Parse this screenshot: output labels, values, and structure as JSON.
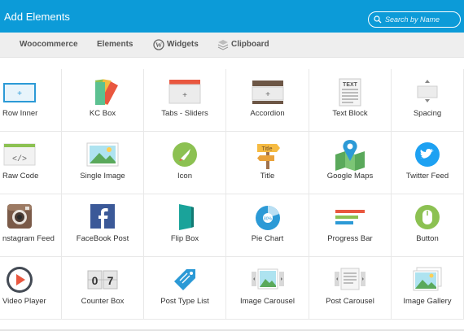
{
  "header": {
    "title": "Add Elements",
    "search_placeholder": "Search by Name"
  },
  "tabs": [
    {
      "label": "Woocommerce",
      "icon": ""
    },
    {
      "label": "Elements",
      "icon": ""
    },
    {
      "label": "Widgets",
      "icon": "wordpress-icon"
    },
    {
      "label": "Clipboard",
      "icon": "layers-icon"
    }
  ],
  "elements": [
    {
      "label": "Row Inner",
      "icon": "row-inner-icon"
    },
    {
      "label": "KC Box",
      "icon": "kc-box-icon"
    },
    {
      "label": "Tabs - Sliders",
      "icon": "tabs-sliders-icon"
    },
    {
      "label": "Accordion",
      "icon": "accordion-icon"
    },
    {
      "label": "Text Block",
      "icon": "text-block-icon"
    },
    {
      "label": "Spacing",
      "icon": "spacing-icon"
    },
    {
      "label": "Raw Code",
      "icon": "raw-code-icon"
    },
    {
      "label": "Single Image",
      "icon": "single-image-icon"
    },
    {
      "label": "Icon",
      "icon": "rocket-icon"
    },
    {
      "label": "Title",
      "icon": "signpost-icon"
    },
    {
      "label": "Google Maps",
      "icon": "map-pin-icon"
    },
    {
      "label": "Twitter Feed",
      "icon": "twitter-icon"
    },
    {
      "label": "nstagram Feed",
      "icon": "instagram-icon"
    },
    {
      "label": "FaceBook Post",
      "icon": "facebook-icon"
    },
    {
      "label": "Flip Box",
      "icon": "flip-box-icon"
    },
    {
      "label": "Pie Chart",
      "icon": "pie-chart-icon"
    },
    {
      "label": "Progress Bar",
      "icon": "progress-bar-icon"
    },
    {
      "label": "Button",
      "icon": "mouse-icon"
    },
    {
      "label": "Video Player",
      "icon": "play-icon"
    },
    {
      "label": "Counter Box",
      "icon": "counter-icon"
    },
    {
      "label": "Post Type List",
      "icon": "tag-icon"
    },
    {
      "label": "Image Carousel",
      "icon": "image-carousel-icon"
    },
    {
      "label": "Post Carousel",
      "icon": "post-carousel-icon"
    },
    {
      "label": "Image Gallery",
      "icon": "image-gallery-icon"
    }
  ],
  "icon_text": {
    "title_sign": "Title",
    "pie_pct": "80%",
    "counter_d1": "0",
    "counter_d2": "7",
    "text_block": "TEXT"
  },
  "colors": {
    "header_bg": "#0c9bd8",
    "tabbar_bg": "#eeeeee"
  }
}
